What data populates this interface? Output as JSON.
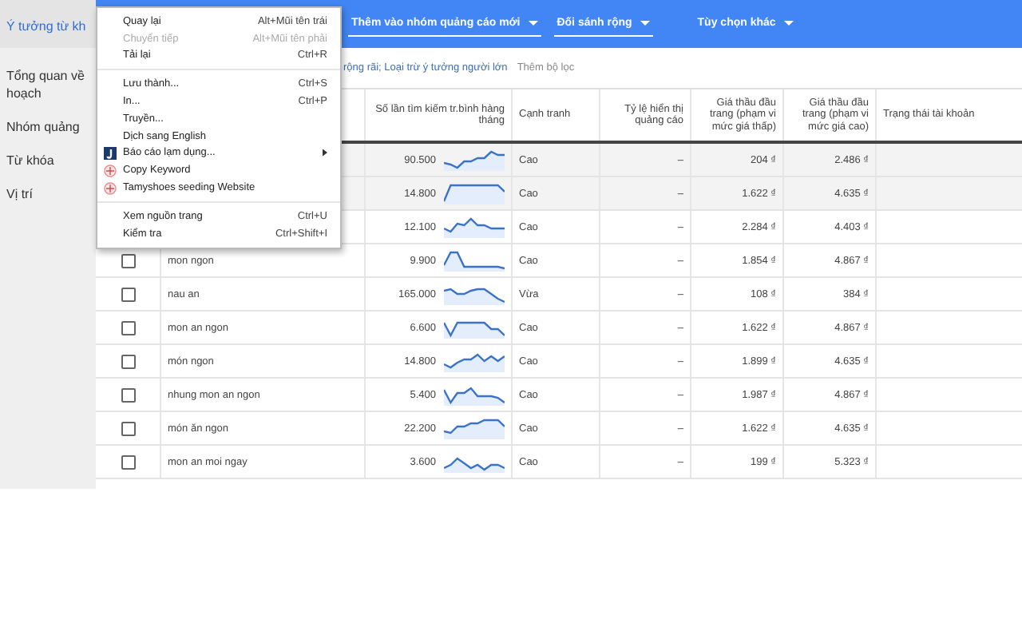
{
  "active_tab": {
    "label": "Ý tưởng từ kh",
    "selected": true
  },
  "toolbar": [
    {
      "label": "Thêm vào nhóm quảng cáo mới",
      "underlined": true
    },
    {
      "label": "Đối sánh rộng",
      "underlined": true
    },
    {
      "label": "Tùy chọn khác",
      "underlined": false
    }
  ],
  "sidebar": {
    "items": [
      {
        "lines": [
          "Tổng quan về",
          "hoạch"
        ]
      },
      {
        "lines": [
          "Nhóm quảng"
        ]
      },
      {
        "lines": [
          "Từ khóa"
        ]
      },
      {
        "lines": [
          "Vị trí"
        ]
      }
    ]
  },
  "filters": {
    "text": "rộng rãi; Loại trừ ý tưởng người lớn",
    "add_filter": "Thêm bộ lọc"
  },
  "table": {
    "columns": [
      "Số lần tìm kiếm tr.bình hàng tháng",
      "Cạnh tranh",
      "Tỷ lệ hiển thị quảng cáo",
      "Giá thầu đầu trang (phạm vi mức giá thấp)",
      "Giá thầu đầu trang (phạm vi mức giá cao)",
      "Trạng thái tài khoản"
    ],
    "rows": [
      {
        "shaded": true,
        "searches": "90.500",
        "competition": "Cao",
        "share": "–",
        "bid_low": "204 ₫",
        "bid_high": "2.486 ₫"
      },
      {
        "shaded": true,
        "searches": "14.800",
        "competition": "Cao",
        "share": "–",
        "bid_low": "1.622 ₫",
        "bid_high": "4.635 ₫"
      },
      {
        "shaded": false,
        "searches": "12.100",
        "competition": "Cao",
        "share": "–",
        "bid_low": "2.284 ₫",
        "bid_high": "4.403 ₫"
      },
      {
        "shaded": false,
        "checked": false,
        "keyword": "mon ngon",
        "searches": "9.900",
        "competition": "Cao",
        "share": "–",
        "bid_low": "1.854 ₫",
        "bid_high": "4.867 ₫"
      },
      {
        "shaded": false,
        "checked": false,
        "keyword": "nau an",
        "searches": "165.000",
        "competition": "Vừa",
        "share": "–",
        "bid_low": "108 ₫",
        "bid_high": "384 ₫"
      },
      {
        "shaded": false,
        "checked": false,
        "keyword": "mon an ngon",
        "searches": "6.600",
        "competition": "Cao",
        "share": "–",
        "bid_low": "1.622 ₫",
        "bid_high": "4.867 ₫"
      },
      {
        "shaded": false,
        "checked": false,
        "keyword": "món ngon",
        "searches": "14.800",
        "competition": "Cao",
        "share": "–",
        "bid_low": "1.899 ₫",
        "bid_high": "4.635 ₫"
      },
      {
        "shaded": false,
        "checked": false,
        "keyword": "nhung mon an ngon",
        "searches": "5.400",
        "competition": "Cao",
        "share": "–",
        "bid_low": "1.987 ₫",
        "bid_high": "4.867 ₫"
      },
      {
        "shaded": false,
        "checked": false,
        "keyword": "món ăn ngon",
        "searches": "22.200",
        "competition": "Cao",
        "share": "–",
        "bid_low": "1.622 ₫",
        "bid_high": "4.635 ₫"
      },
      {
        "shaded": false,
        "checked": false,
        "keyword": "mon an moi ngay",
        "searches": "3.600",
        "competition": "Cao",
        "share": "–",
        "bid_low": "199 ₫",
        "bid_high": "5.323 ₫"
      }
    ]
  },
  "context_menu": {
    "items": [
      {
        "kind": "item",
        "label": "Quay lại",
        "shortcut": "Alt+Mũi tên trái",
        "disabled": false
      },
      {
        "kind": "item",
        "label": "Chuyển tiếp",
        "shortcut": "Alt+Mũi tên phải",
        "disabled": true
      },
      {
        "kind": "item",
        "label": "Tải lại",
        "shortcut": "Ctrl+R",
        "disabled": false
      },
      {
        "kind": "separator"
      },
      {
        "kind": "item",
        "label": "Lưu thành...",
        "shortcut": "Ctrl+S",
        "disabled": false
      },
      {
        "kind": "item",
        "label": "In...",
        "shortcut": "Ctrl+P",
        "disabled": false
      },
      {
        "kind": "item",
        "label": "Truyền...",
        "disabled": false
      },
      {
        "kind": "item",
        "label": "Dịch sang English",
        "disabled": false
      },
      {
        "kind": "extension_submenu",
        "label": "Báo cáo lạm dụng...",
        "disabled": false
      },
      {
        "kind": "stamp_item",
        "label": "Copy Keyword",
        "disabled": false
      },
      {
        "kind": "stamp_item",
        "label": "Tamyshoes seeding Website",
        "disabled": false
      },
      {
        "kind": "separator"
      },
      {
        "kind": "item",
        "label": "Xem nguồn trang",
        "shortcut": "Ctrl+U",
        "disabled": false
      },
      {
        "kind": "item",
        "label": "Kiểm tra",
        "shortcut": "Ctrl+Shift+I",
        "disabled": false
      }
    ]
  }
}
